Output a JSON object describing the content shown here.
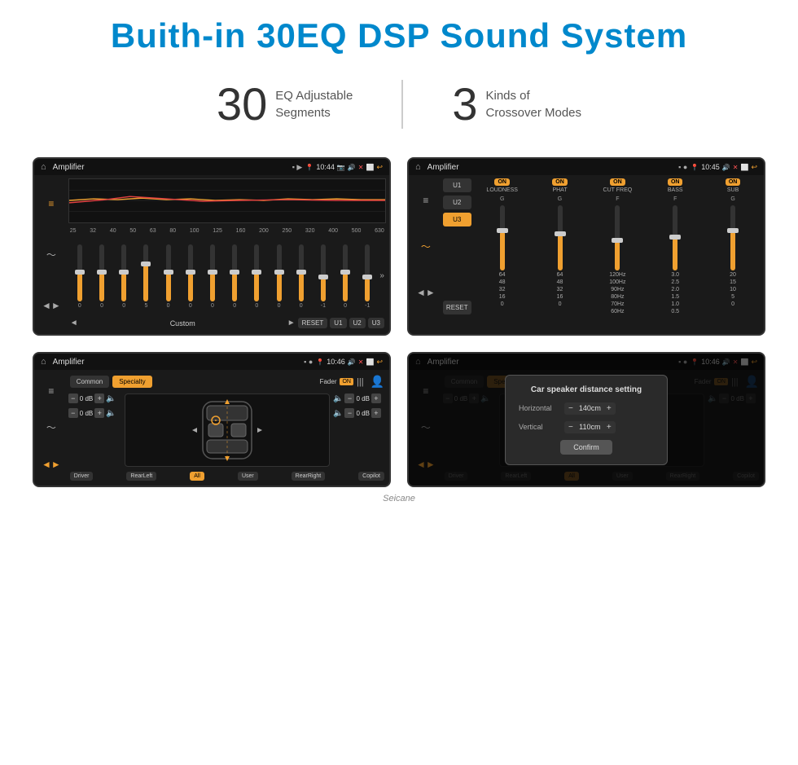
{
  "page": {
    "title": "Buith-in 30EQ DSP Sound System",
    "stat1_number": "30",
    "stat1_label": "EQ Adjustable\nSegments",
    "stat2_number": "3",
    "stat2_label": "Kinds of\nCrossover Modes",
    "watermark": "Seicane"
  },
  "screen1": {
    "status_title": "Amplifier",
    "time": "10:44",
    "eq_freqs": [
      "25",
      "32",
      "40",
      "50",
      "63",
      "80",
      "100",
      "125",
      "160",
      "200",
      "250",
      "320",
      "400",
      "500",
      "630"
    ],
    "bottom_label": "Custom",
    "buttons": [
      "RESET",
      "U1",
      "U2",
      "U3"
    ],
    "slider_values": [
      "0",
      "0",
      "0",
      "5",
      "0",
      "0",
      "0",
      "0",
      "0",
      "0",
      "0",
      "-1",
      "0",
      "-1"
    ]
  },
  "screen2": {
    "status_title": "Amplifier",
    "time": "10:45",
    "presets": [
      "U1",
      "U2",
      "U3"
    ],
    "active_preset": "U3",
    "channels": [
      "LOUDNESS",
      "PHAT",
      "CUT FREQ",
      "BASS",
      "SUB"
    ],
    "channel_on": [
      true,
      true,
      true,
      true,
      true
    ],
    "reset_label": "RESET"
  },
  "screen3": {
    "status_title": "Amplifier",
    "time": "10:46",
    "btn_common": "Common",
    "btn_specialty": "Specialty",
    "fader_label": "Fader",
    "fader_on": "ON",
    "db_values": [
      "0 dB",
      "0 dB",
      "0 dB",
      "0 dB"
    ],
    "bottom_buttons": [
      "Driver",
      "RearLeft",
      "All",
      "User",
      "RearRight",
      "Copilot"
    ]
  },
  "screen4": {
    "status_title": "Amplifier",
    "time": "10:46",
    "btn_common": "Common",
    "btn_specialty": "Specialty",
    "dialog": {
      "title": "Car speaker distance setting",
      "horizontal_label": "Horizontal",
      "horizontal_value": "140cm",
      "vertical_label": "Vertical",
      "vertical_value": "110cm",
      "confirm_label": "Confirm",
      "db_right": "0 dB"
    },
    "bottom_buttons": [
      "Driver",
      "RearLeft",
      "All",
      "User",
      "RearRight",
      "Copilot"
    ]
  }
}
